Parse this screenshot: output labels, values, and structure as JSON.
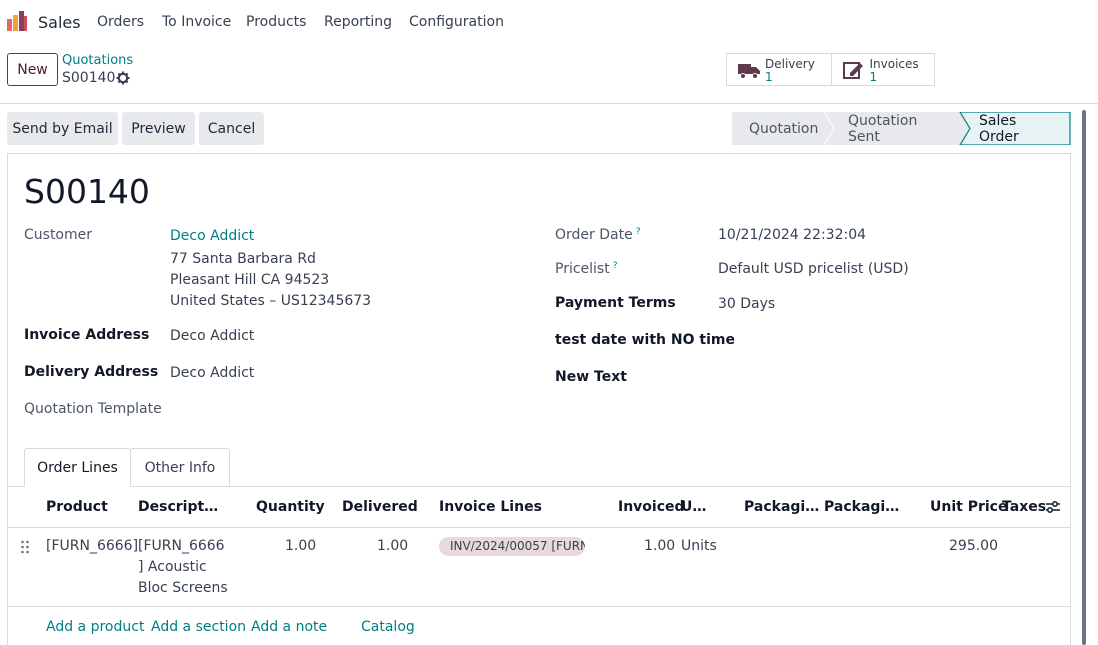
{
  "navbar": {
    "app_name": "Sales",
    "menu": [
      "Orders",
      "To Invoice",
      "Products",
      "Reporting",
      "Configuration"
    ]
  },
  "control_panel": {
    "new_label": "New",
    "breadcrumb": "Quotations",
    "record": "S00140",
    "smart_buttons": [
      {
        "label": "Delivery",
        "count": "1",
        "icon": "truck-icon"
      },
      {
        "label": "Invoices",
        "count": "1",
        "icon": "invoice-edit-icon"
      }
    ]
  },
  "actions": {
    "send_email": "Send by Email",
    "preview": "Preview",
    "cancel": "Cancel"
  },
  "stages": {
    "items": [
      "Quotation",
      "Quotation Sent",
      "Sales Order"
    ],
    "current": "Sales Order"
  },
  "form": {
    "title": "S00140",
    "customer_label": "Customer",
    "customer_name": "Deco Addict",
    "address_line1": "77 Santa Barbara Rd",
    "address_line2": "Pleasant Hill CA 94523",
    "address_line3": "United States – US12345673",
    "invoice_address_label": "Invoice Address",
    "invoice_address": "Deco Addict",
    "delivery_address_label": "Delivery Address",
    "delivery_address": "Deco Addict",
    "quotation_template_label": "Quotation Template",
    "order_date_label": "Order Date",
    "order_date": "10/21/2024 22:32:04",
    "pricelist_label": "Pricelist",
    "pricelist": "Default USD pricelist (USD)",
    "payment_terms_label": "Payment Terms",
    "payment_terms": "30 Days",
    "test_date_label": "test date with NO time",
    "new_text_label": "New Text",
    "help_mark": "?"
  },
  "tabs": [
    "Order Lines",
    "Other Info"
  ],
  "table": {
    "headers": [
      "Product",
      "Descript…",
      "Quantity",
      "Delivered",
      "Invoice Lines",
      "Invoiced",
      "U…",
      "Packagi…",
      "Packagi…",
      "Unit Price",
      "Taxes"
    ],
    "row": {
      "product": "[FURN_6666]",
      "desc_line1": "[FURN_6666",
      "desc_line2": "] Acoustic",
      "desc_line3": "Bloc Screens",
      "quantity": "1.00",
      "delivered": "1.00",
      "invoice_line": "INV/2024/00057 [FURN",
      "invoiced": "1.00",
      "uom": "Units",
      "unit_price": "295.00"
    },
    "add_links": [
      "Add a product",
      "Add a section",
      "Add a note",
      "Catalog"
    ]
  },
  "colors": {
    "accent": "#017e84",
    "brand": "#714b67"
  }
}
